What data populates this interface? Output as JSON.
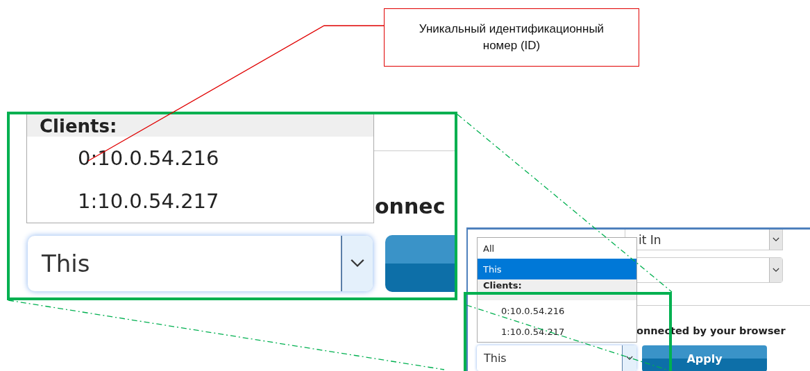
{
  "callout": {
    "text": "Уникальный идентификационный номер (ID)"
  },
  "zoom_inset": {
    "list": [
      {
        "kind": "header",
        "label": "Clients:",
        "selected": false
      },
      {
        "kind": "option",
        "label": "0:10.0.54.216",
        "selected": false
      },
      {
        "kind": "option",
        "label": "1:10.0.54.217",
        "selected": false
      }
    ],
    "side_text": "onnec",
    "select_value": "This"
  },
  "screen": {
    "stretch_value": "it In",
    "list": [
      {
        "kind": "option",
        "label": "All",
        "selected": false
      },
      {
        "kind": "option",
        "label": "This",
        "selected": true
      },
      {
        "kind": "header",
        "label": "Clients:",
        "selected": false
      },
      {
        "kind": "option",
        "label": "0:10.0.54.216",
        "selected": false
      },
      {
        "kind": "option",
        "label": "1:10.0.54.217",
        "selected": false
      }
    ],
    "side_text": "onnected by your browser",
    "select_value": "This",
    "button": "Apply"
  }
}
